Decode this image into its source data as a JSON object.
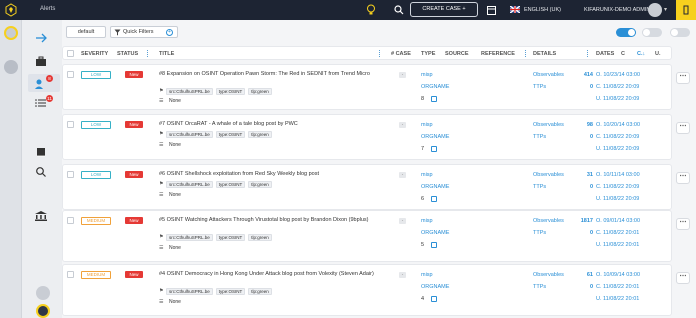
{
  "topbar": {
    "title": "Alerts",
    "create_case_label": "CREATE CASE",
    "create_case_icon": "+",
    "language": "ENGLISH (UK)",
    "user": "KIFARUNIX-DEMO ADMIN",
    "caret": "▾"
  },
  "filters": {
    "default_label": "default",
    "quick_filters_label": "Quick Filters",
    "plus": "+"
  },
  "table": {
    "headers": {
      "severity": "SEVERITY",
      "status": "STATUS",
      "title": "TITLE",
      "case": "# CASE",
      "type": "TYPE",
      "source": "SOURCE",
      "reference": "REFERENCE",
      "details": "DETAILS",
      "dates": "DATES",
      "dates_c": "C",
      "dates_ca": "C.↓",
      "dates_u": "U."
    },
    "rows": [
      {
        "severity": "LOW",
        "status": "New",
        "title": "#8 Expansion on OSINT Operation Pawn Storm: The Red in SEDNIT from Trend Micro",
        "tags": [
          "src:CthulhuSPRL.be",
          "type:OSINT",
          "tlp:green"
        ],
        "none": "None",
        "case": "-",
        "type": "misp",
        "source": "ORGNAME",
        "count": "8",
        "observables_label": "Observables",
        "observables": "414",
        "ttps_label": "TTPs",
        "ttps": "0",
        "date_o": "O. 10/23/14 03:00",
        "date_c": "C. 11/08/22 20:09",
        "date_u": "U. 11/08/22 20:09"
      },
      {
        "severity": "LOW",
        "status": "New",
        "title": "#7 OSINT OrcaRAT - A whale of a tale blog post by PWC",
        "tags": [
          "src:CthulhuSPRL.be",
          "type:OSINT",
          "tlp:green"
        ],
        "none": "None",
        "case": "-",
        "type": "misp",
        "source": "ORGNAME",
        "count": "7",
        "observables_label": "Observables",
        "observables": "98",
        "ttps_label": "TTPs",
        "ttps": "0",
        "date_o": "O. 10/20/14 03:00",
        "date_c": "C. 11/08/22 20:09",
        "date_u": "U. 11/08/22 20:09"
      },
      {
        "severity": "LOW",
        "status": "New",
        "title": "#6 OSINT Shellshock exploitation from Red Sky Weekly blog post",
        "tags": [
          "src:CthulhuSPRL.be",
          "type:OSINT",
          "tlp:green"
        ],
        "none": "None",
        "case": "-",
        "type": "misp",
        "source": "ORGNAME",
        "count": "6",
        "observables_label": "Observables",
        "observables": "31",
        "ttps_label": "TTPs",
        "ttps": "0",
        "date_o": "O. 10/11/14 03:00",
        "date_c": "C. 11/08/22 20:09",
        "date_u": "U. 11/08/22 20:09"
      },
      {
        "severity": "MEDIUM",
        "status": "New",
        "title": "#5 OSINT Watching Attackers Through Virustotal blog post by Brandon Dixon (9bplus)",
        "tags": [
          "src:CthulhuSPRL.be",
          "type:OSINT",
          "tlp:green"
        ],
        "none": "None",
        "case": "-",
        "type": "misp",
        "source": "ORGNAME",
        "count": "5",
        "observables_label": "Observables",
        "observables": "1817",
        "ttps_label": "TTPs",
        "ttps": "0",
        "date_o": "O. 09/01/14 03:00",
        "date_c": "C. 11/08/22 20:01",
        "date_u": "U. 11/08/22 20:01"
      },
      {
        "severity": "MEDIUM",
        "status": "New",
        "title": "#4 OSINT Democracy in Hong Kong Under Attack blog post from Volexity (Steven Adair)",
        "tags": [
          "src:CthulhuSPRL.be",
          "type:OSINT",
          "tlp:green"
        ],
        "none": "None",
        "case": "-",
        "type": "misp",
        "source": "ORGNAME",
        "count": "4",
        "observables_label": "Observables",
        "observables": "61",
        "ttps_label": "TTPs",
        "ttps": "0",
        "date_o": "O. 10/09/14 03:00",
        "date_c": "C. 11/08/22 20:01",
        "date_u": "U. 11/08/22 20:01"
      }
    ]
  },
  "badges": {
    "alerts": "8",
    "tasks": "11"
  },
  "colors": {
    "low": "#35b0c6",
    "medium": "#f0a13a",
    "status_new": "#e53935",
    "accent": "#2a8fd6",
    "topbar": "#1d2433",
    "brand": "#f6d01e"
  },
  "icons": [
    "logo-icon",
    "lightbulb-icon",
    "search-icon",
    "calendar-icon",
    "uk-flag-icon",
    "arrow-right-icon",
    "briefcase-icon",
    "alerts-icon",
    "tasks-icon",
    "book-icon",
    "search-nav-icon",
    "bank-icon",
    "chat-icon",
    "filter-icon",
    "external-link-icon",
    "more-icon"
  ]
}
